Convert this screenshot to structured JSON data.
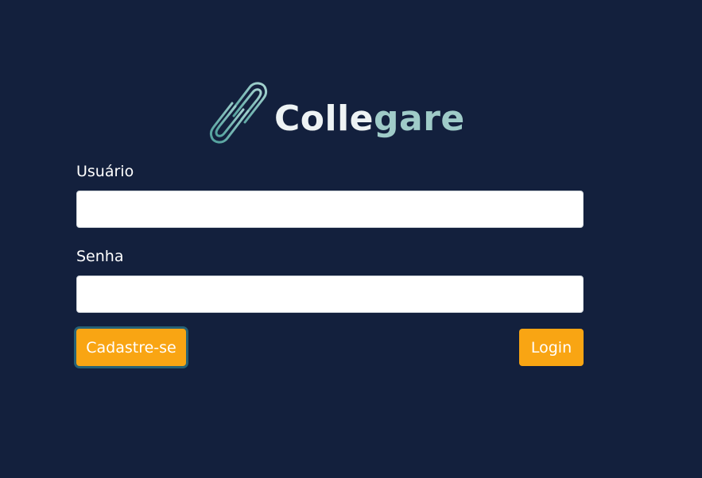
{
  "logo": {
    "word_part1": "Colle",
    "word_part2": "gare",
    "mark_icon": "chain-link-icon",
    "mark_color_light": "#8ec9c5",
    "mark_color_dark": "#5ba7a3"
  },
  "form": {
    "username_label": "Usuário",
    "username_value": "",
    "username_placeholder": "",
    "password_label": "Senha",
    "password_value": "",
    "password_placeholder": ""
  },
  "actions": {
    "register_label": "Cadastre-se",
    "login_label": "Login"
  },
  "colors": {
    "background": "#13203d",
    "button": "#f9a513",
    "button_text": "#ffffff",
    "focus_ring": "#276276"
  }
}
